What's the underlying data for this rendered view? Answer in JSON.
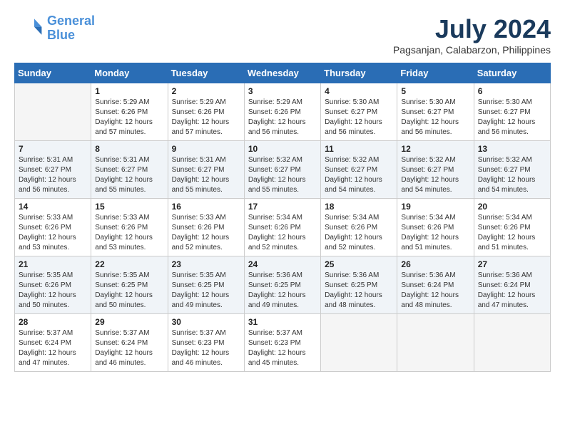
{
  "header": {
    "logo_line1": "General",
    "logo_line2": "Blue",
    "month_year": "July 2024",
    "location": "Pagsanjan, Calabarzon, Philippines"
  },
  "weekdays": [
    "Sunday",
    "Monday",
    "Tuesday",
    "Wednesday",
    "Thursday",
    "Friday",
    "Saturday"
  ],
  "weeks": [
    [
      {
        "day": "",
        "content": ""
      },
      {
        "day": "1",
        "content": "Sunrise: 5:29 AM\nSunset: 6:26 PM\nDaylight: 12 hours\nand 57 minutes."
      },
      {
        "day": "2",
        "content": "Sunrise: 5:29 AM\nSunset: 6:26 PM\nDaylight: 12 hours\nand 57 minutes."
      },
      {
        "day": "3",
        "content": "Sunrise: 5:29 AM\nSunset: 6:26 PM\nDaylight: 12 hours\nand 56 minutes."
      },
      {
        "day": "4",
        "content": "Sunrise: 5:30 AM\nSunset: 6:27 PM\nDaylight: 12 hours\nand 56 minutes."
      },
      {
        "day": "5",
        "content": "Sunrise: 5:30 AM\nSunset: 6:27 PM\nDaylight: 12 hours\nand 56 minutes."
      },
      {
        "day": "6",
        "content": "Sunrise: 5:30 AM\nSunset: 6:27 PM\nDaylight: 12 hours\nand 56 minutes."
      }
    ],
    [
      {
        "day": "7",
        "content": "Sunrise: 5:31 AM\nSunset: 6:27 PM\nDaylight: 12 hours\nand 56 minutes."
      },
      {
        "day": "8",
        "content": "Sunrise: 5:31 AM\nSunset: 6:27 PM\nDaylight: 12 hours\nand 55 minutes."
      },
      {
        "day": "9",
        "content": "Sunrise: 5:31 AM\nSunset: 6:27 PM\nDaylight: 12 hours\nand 55 minutes."
      },
      {
        "day": "10",
        "content": "Sunrise: 5:32 AM\nSunset: 6:27 PM\nDaylight: 12 hours\nand 55 minutes."
      },
      {
        "day": "11",
        "content": "Sunrise: 5:32 AM\nSunset: 6:27 PM\nDaylight: 12 hours\nand 54 minutes."
      },
      {
        "day": "12",
        "content": "Sunrise: 5:32 AM\nSunset: 6:27 PM\nDaylight: 12 hours\nand 54 minutes."
      },
      {
        "day": "13",
        "content": "Sunrise: 5:32 AM\nSunset: 6:27 PM\nDaylight: 12 hours\nand 54 minutes."
      }
    ],
    [
      {
        "day": "14",
        "content": "Sunrise: 5:33 AM\nSunset: 6:26 PM\nDaylight: 12 hours\nand 53 minutes."
      },
      {
        "day": "15",
        "content": "Sunrise: 5:33 AM\nSunset: 6:26 PM\nDaylight: 12 hours\nand 53 minutes."
      },
      {
        "day": "16",
        "content": "Sunrise: 5:33 AM\nSunset: 6:26 PM\nDaylight: 12 hours\nand 52 minutes."
      },
      {
        "day": "17",
        "content": "Sunrise: 5:34 AM\nSunset: 6:26 PM\nDaylight: 12 hours\nand 52 minutes."
      },
      {
        "day": "18",
        "content": "Sunrise: 5:34 AM\nSunset: 6:26 PM\nDaylight: 12 hours\nand 52 minutes."
      },
      {
        "day": "19",
        "content": "Sunrise: 5:34 AM\nSunset: 6:26 PM\nDaylight: 12 hours\nand 51 minutes."
      },
      {
        "day": "20",
        "content": "Sunrise: 5:34 AM\nSunset: 6:26 PM\nDaylight: 12 hours\nand 51 minutes."
      }
    ],
    [
      {
        "day": "21",
        "content": "Sunrise: 5:35 AM\nSunset: 6:26 PM\nDaylight: 12 hours\nand 50 minutes."
      },
      {
        "day": "22",
        "content": "Sunrise: 5:35 AM\nSunset: 6:25 PM\nDaylight: 12 hours\nand 50 minutes."
      },
      {
        "day": "23",
        "content": "Sunrise: 5:35 AM\nSunset: 6:25 PM\nDaylight: 12 hours\nand 49 minutes."
      },
      {
        "day": "24",
        "content": "Sunrise: 5:36 AM\nSunset: 6:25 PM\nDaylight: 12 hours\nand 49 minutes."
      },
      {
        "day": "25",
        "content": "Sunrise: 5:36 AM\nSunset: 6:25 PM\nDaylight: 12 hours\nand 48 minutes."
      },
      {
        "day": "26",
        "content": "Sunrise: 5:36 AM\nSunset: 6:24 PM\nDaylight: 12 hours\nand 48 minutes."
      },
      {
        "day": "27",
        "content": "Sunrise: 5:36 AM\nSunset: 6:24 PM\nDaylight: 12 hours\nand 47 minutes."
      }
    ],
    [
      {
        "day": "28",
        "content": "Sunrise: 5:37 AM\nSunset: 6:24 PM\nDaylight: 12 hours\nand 47 minutes."
      },
      {
        "day": "29",
        "content": "Sunrise: 5:37 AM\nSunset: 6:24 PM\nDaylight: 12 hours\nand 46 minutes."
      },
      {
        "day": "30",
        "content": "Sunrise: 5:37 AM\nSunset: 6:23 PM\nDaylight: 12 hours\nand 46 minutes."
      },
      {
        "day": "31",
        "content": "Sunrise: 5:37 AM\nSunset: 6:23 PM\nDaylight: 12 hours\nand 45 minutes."
      },
      {
        "day": "",
        "content": ""
      },
      {
        "day": "",
        "content": ""
      },
      {
        "day": "",
        "content": ""
      }
    ]
  ]
}
